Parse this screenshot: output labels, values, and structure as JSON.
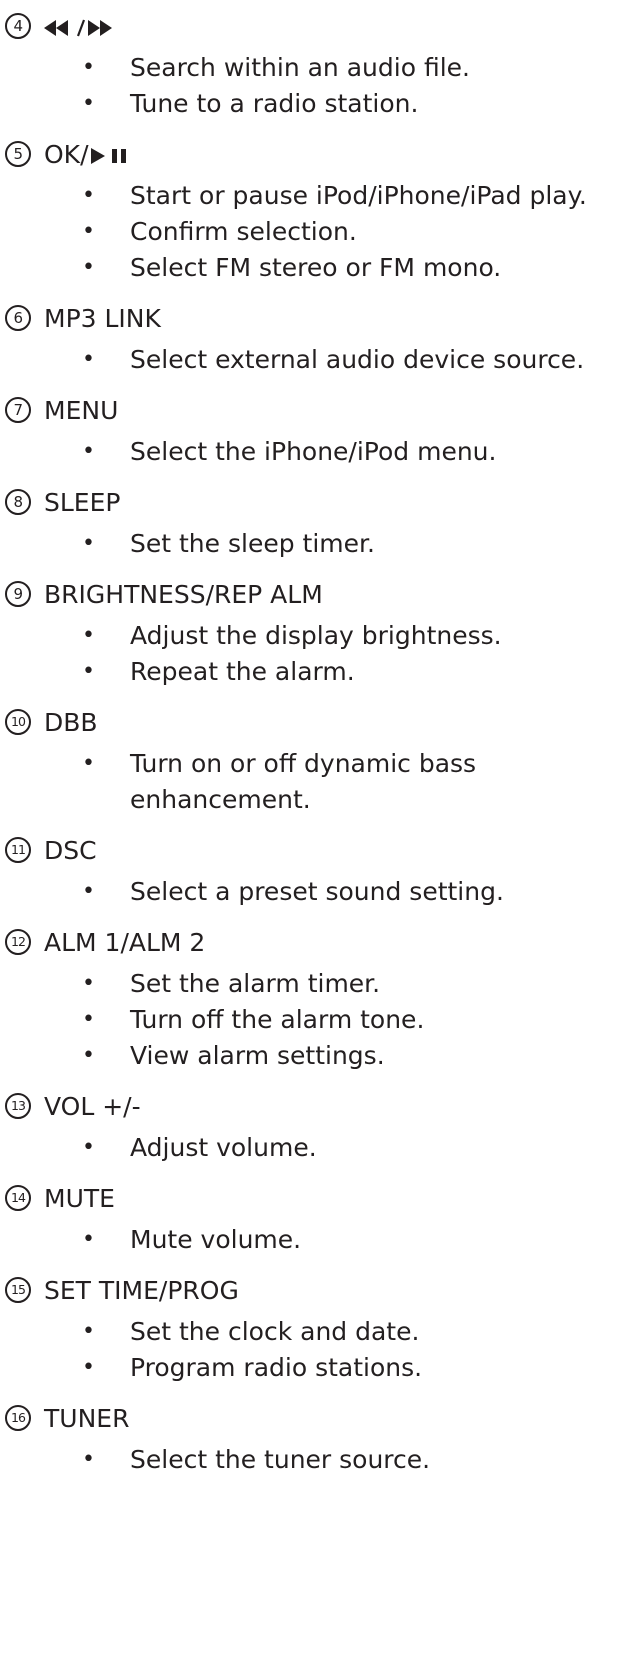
{
  "items": [
    {
      "number": "4",
      "title": "◀◀/▶▶",
      "title_icon": "rewind-forward-icon",
      "bullets": [
        "Search within an audio file.",
        "Tune to a radio station."
      ]
    },
    {
      "number": "5",
      "title": "OK/",
      "title_icon": "play-pause-icon",
      "bullets": [
        "Start or pause iPod/iPhone/iPad play.",
        "Confirm selection.",
        "Select FM stereo or FM mono."
      ]
    },
    {
      "number": "6",
      "title": "MP3 LINK",
      "bullets": [
        "Select external audio device source."
      ]
    },
    {
      "number": "7",
      "title": "MENU",
      "bullets": [
        "Select the iPhone/iPod menu."
      ]
    },
    {
      "number": "8",
      "title": "SLEEP",
      "bullets": [
        "Set the sleep timer."
      ]
    },
    {
      "number": "9",
      "title": "BRIGHTNESS/REP ALM",
      "bullets": [
        "Adjust the display brightness.",
        "Repeat the alarm."
      ]
    },
    {
      "number": "10",
      "title": "DBB",
      "bullets": [
        "Turn on or off dynamic bass enhancement."
      ]
    },
    {
      "number": "11",
      "title": "DSC",
      "bullets": [
        "Select a preset sound setting."
      ]
    },
    {
      "number": "12",
      "title": "ALM 1/ALM 2",
      "bullets": [
        "Set the alarm timer.",
        "Turn off the alarm tone.",
        "View alarm settings."
      ]
    },
    {
      "number": "13",
      "title": "VOL +/-",
      "bullets": [
        "Adjust volume."
      ]
    },
    {
      "number": "14",
      "title": "MUTE",
      "bullets": [
        "Mute volume."
      ]
    },
    {
      "number": "15",
      "title": "SET TIME/PROG",
      "bullets": [
        "Set the clock and date.",
        "Program radio stations."
      ]
    },
    {
      "number": "16",
      "title": "TUNER",
      "bullets": [
        "Select the tuner source."
      ]
    }
  ],
  "bullet_symbol": "•"
}
